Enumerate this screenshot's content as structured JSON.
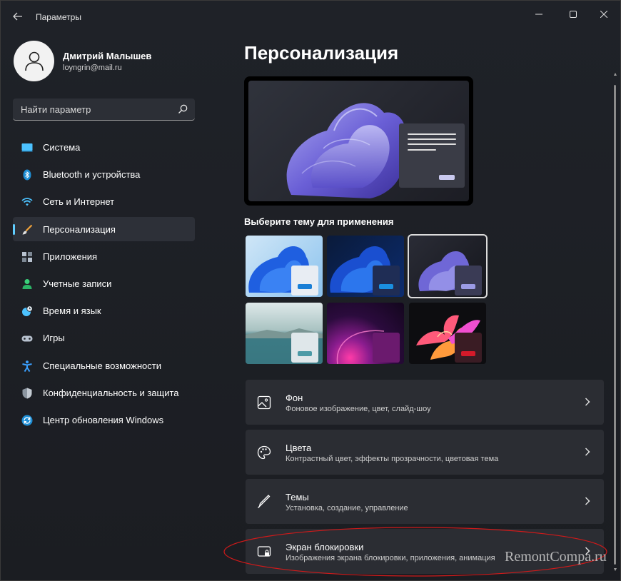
{
  "window": {
    "title": "Параметры"
  },
  "profile": {
    "name": "Дмитрий Малышев",
    "email": "loyngrin@mail.ru"
  },
  "search": {
    "placeholder": "Найти параметр"
  },
  "sidebar": {
    "items": [
      {
        "label": "Система",
        "icon": "system-icon",
        "active": false
      },
      {
        "label": "Bluetooth и устройства",
        "icon": "bluetooth-icon",
        "active": false
      },
      {
        "label": "Сеть и Интернет",
        "icon": "wifi-icon",
        "active": false
      },
      {
        "label": "Персонализация",
        "icon": "brush-icon",
        "active": true
      },
      {
        "label": "Приложения",
        "icon": "apps-icon",
        "active": false
      },
      {
        "label": "Учетные записи",
        "icon": "account-icon",
        "active": false
      },
      {
        "label": "Время и язык",
        "icon": "time-language-icon",
        "active": false
      },
      {
        "label": "Игры",
        "icon": "gamepad-icon",
        "active": false
      },
      {
        "label": "Специальные возможности",
        "icon": "accessibility-icon",
        "active": false
      },
      {
        "label": "Конфиденциальность и защита",
        "icon": "shield-icon",
        "active": false
      },
      {
        "label": "Центр обновления Windows",
        "icon": "update-icon",
        "active": false
      }
    ]
  },
  "main": {
    "title": "Персонализация",
    "themes_heading": "Выберите тему для применения",
    "themes": [
      {
        "name": "windows-light",
        "selected": false
      },
      {
        "name": "windows-dark",
        "selected": false
      },
      {
        "name": "glow",
        "selected": true
      },
      {
        "name": "captured-motion",
        "selected": false
      },
      {
        "name": "sunrise",
        "selected": false
      },
      {
        "name": "flow",
        "selected": false
      }
    ],
    "settings": [
      {
        "title": "Фон",
        "subtitle": "Фоновое изображение, цвет, слайд-шоу",
        "icon": "image-icon"
      },
      {
        "title": "Цвета",
        "subtitle": "Контрастный цвет, эффекты прозрачности, цветовая тема",
        "icon": "palette-icon"
      },
      {
        "title": "Темы",
        "subtitle": "Установка, создание, управление",
        "icon": "pen-icon"
      },
      {
        "title": "Экран блокировки",
        "subtitle": "Изображения экрана блокировки, приложения, анимация",
        "icon": "lock-screen-icon"
      }
    ]
  },
  "colors": {
    "accent": "#60cdff",
    "annotation": "#d01a1a"
  },
  "watermark": "RemontCompa.ru"
}
